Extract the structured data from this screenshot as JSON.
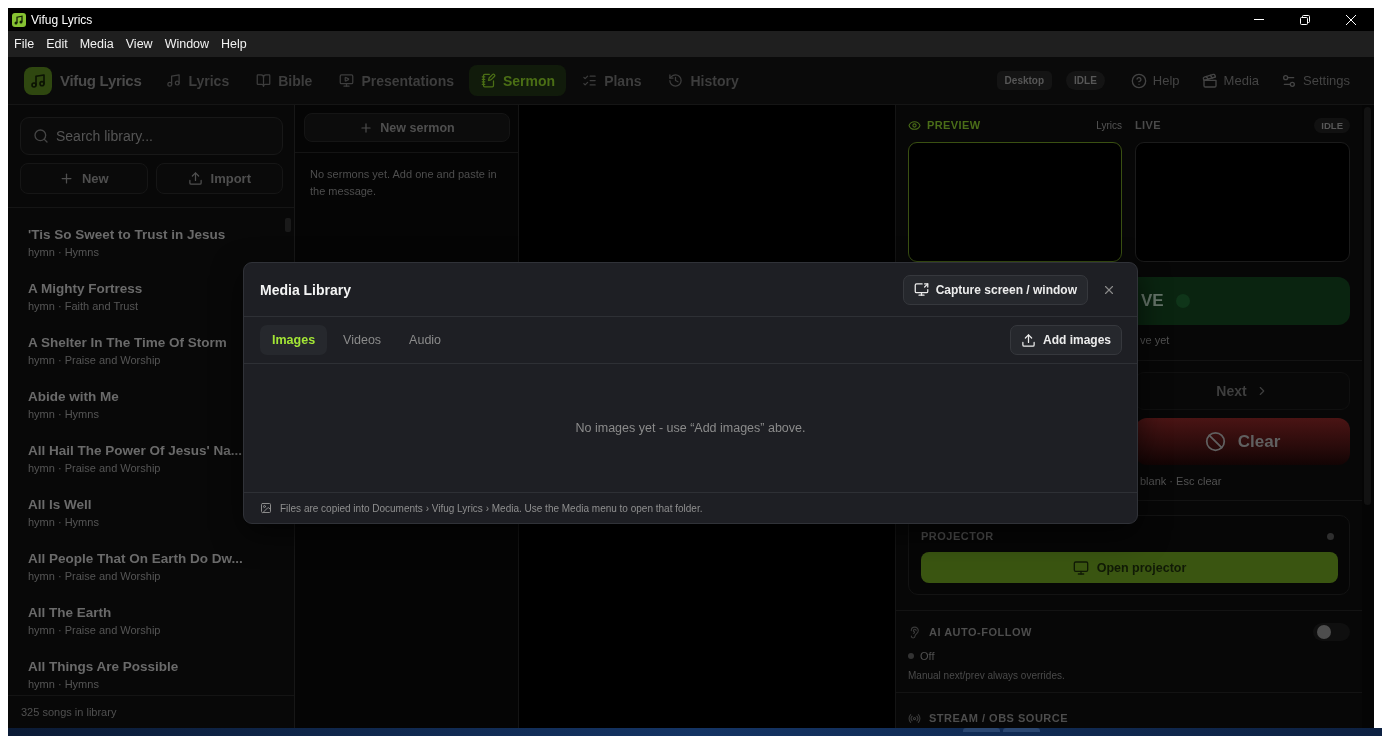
{
  "window": {
    "title": "Vifug Lyrics"
  },
  "menu": [
    "File",
    "Edit",
    "Media",
    "View",
    "Window",
    "Help"
  ],
  "app_header": {
    "brand": "Vifug Lyrics",
    "nav": [
      {
        "label": "Lyrics",
        "selected": false
      },
      {
        "label": "Bible",
        "selected": false
      },
      {
        "label": "Presentations",
        "selected": false
      },
      {
        "label": "Sermon",
        "selected": true
      },
      {
        "label": "Plans",
        "selected": false
      },
      {
        "label": "History",
        "selected": false
      }
    ],
    "badges": [
      "Desktop",
      "IDLE"
    ],
    "actions": [
      "Help",
      "Media",
      "Settings"
    ]
  },
  "library": {
    "search": {
      "placeholder": "Search library..."
    },
    "buttons": [
      "New",
      "Import"
    ],
    "songs": [
      {
        "title": "'Tis So Sweet to Trust in Jesus",
        "subtitle": "hymn · Hymns"
      },
      {
        "title": "A Mighty Fortress",
        "subtitle": "hymn · Faith and Trust"
      },
      {
        "title": "A Shelter In The Time Of Storm",
        "subtitle": "hymn · Praise and Worship"
      },
      {
        "title": "Abide with Me",
        "subtitle": "hymn · Hymns"
      },
      {
        "title": "All Hail The Power Of Jesus' Na...",
        "subtitle": "hymn · Praise and Worship"
      },
      {
        "title": "All Is Well",
        "subtitle": "hymn · Hymns"
      },
      {
        "title": "All People That On Earth Do Dw...",
        "subtitle": "hymn · Praise and Worship"
      },
      {
        "title": "All The Earth",
        "subtitle": "hymn · Praise and Worship"
      },
      {
        "title": "All Things Are Possible",
        "subtitle": "hymn · Hymns"
      }
    ],
    "footer": "325 songs in library"
  },
  "sermons": {
    "new_button": "New sermon",
    "empty_message": "No sermons yet. Add one and paste in the message."
  },
  "output_panel": {
    "preview": {
      "label": "PREVIEW",
      "source": "Lyrics"
    },
    "live": {
      "label": "LIVE",
      "status": "IDLE"
    },
    "go_live_button": "VE",
    "live_note": "ve yet",
    "next_button": "Next",
    "clear_button": "Clear",
    "shortcut_note": "blank · Esc clear",
    "projector": {
      "title": "PROJECTOR",
      "button": "Open projector"
    },
    "auto_follow": {
      "title": "AI AUTO-FOLLOW",
      "on": false,
      "status": "Off",
      "note": "Manual next/prev always overrides."
    },
    "stream": {
      "title": "STREAM / OBS SOURCE"
    }
  },
  "media_dialog": {
    "title": "Media Library",
    "capture_button": "Capture screen / window",
    "tabs": [
      {
        "label": "Images",
        "selected": true
      },
      {
        "label": "Videos",
        "selected": false
      },
      {
        "label": "Audio",
        "selected": false
      }
    ],
    "add_button": "Add images",
    "empty_message": "No images yet - use “Add images” above.",
    "footer": "Files are copied into Documents › Vifug Lyrics › Media. Use the Media menu to open that folder."
  }
}
